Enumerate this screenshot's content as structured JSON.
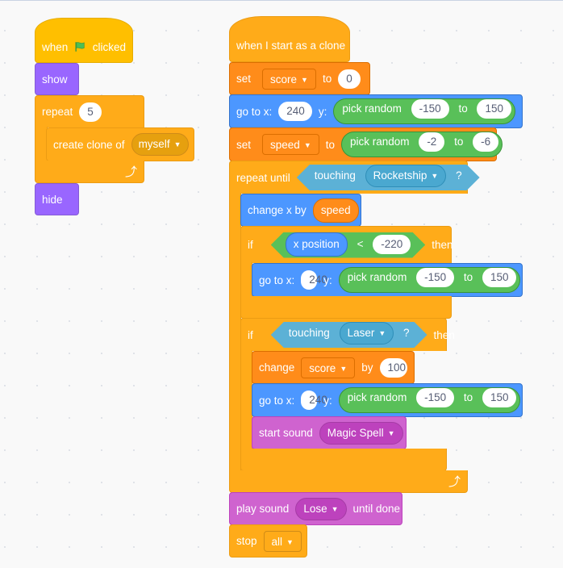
{
  "script1": {
    "hat": {
      "when": "when",
      "icon": "green-flag-icon",
      "clicked": "clicked"
    },
    "show": "show",
    "repeat": {
      "label": "repeat",
      "count": "5"
    },
    "create_clone": {
      "label": "create clone of",
      "target": "myself"
    },
    "hide": "hide"
  },
  "script2": {
    "hat": "when I start as a clone",
    "set_score": {
      "label": "set",
      "variable": "score",
      "to": "to",
      "value": "0"
    },
    "goto1": {
      "label": "go to x:",
      "x": "240",
      "y_label": "y:",
      "random": "pick random",
      "from": "-150",
      "to_label": "to",
      "to": "150"
    },
    "set_speed": {
      "label": "set",
      "variable": "speed",
      "to": "to",
      "random": "pick random",
      "from": "-2",
      "to_label": "to",
      "to_value": "-6"
    },
    "repeat_until": {
      "label": "repeat until",
      "touching": "touching",
      "object": "Rocketship",
      "q": "?"
    },
    "change_x": {
      "label": "change x by",
      "value": "speed"
    },
    "if1": {
      "label": "if",
      "reporter": "x position",
      "op": "<",
      "value": "-220",
      "then": "then"
    },
    "goto2": {
      "label": "go to x:",
      "x": "240",
      "y_label": "y:",
      "random": "pick random",
      "from": "-150",
      "to_label": "to",
      "to": "150"
    },
    "if2": {
      "label": "if",
      "touching": "touching",
      "object": "Laser",
      "q": "?",
      "then": "then"
    },
    "change_score": {
      "label": "change",
      "variable": "score",
      "by": "by",
      "value": "100"
    },
    "goto3": {
      "label": "go to x:",
      "x": "240",
      "y_label": "y:",
      "random": "pick random",
      "from": "-150",
      "to_label": "to",
      "to": "150"
    },
    "start_sound": {
      "label": "start sound",
      "sound": "Magic Spell"
    },
    "play_sound": {
      "label": "play sound",
      "sound": "Lose",
      "until": "until done"
    },
    "stop": {
      "label": "stop",
      "option": "all"
    }
  },
  "icons": {
    "caret": "▼",
    "loop": "⤴"
  },
  "colors": {
    "events": "#ffbf00",
    "control": "#ffab19",
    "looks": "#9966ff",
    "motion": "#4c97ff",
    "variables": "#ff8c1a",
    "operators": "#59c059",
    "sensing": "#5cb1d6",
    "sound": "#cf63cf",
    "workspace": "#f9f9f9"
  }
}
